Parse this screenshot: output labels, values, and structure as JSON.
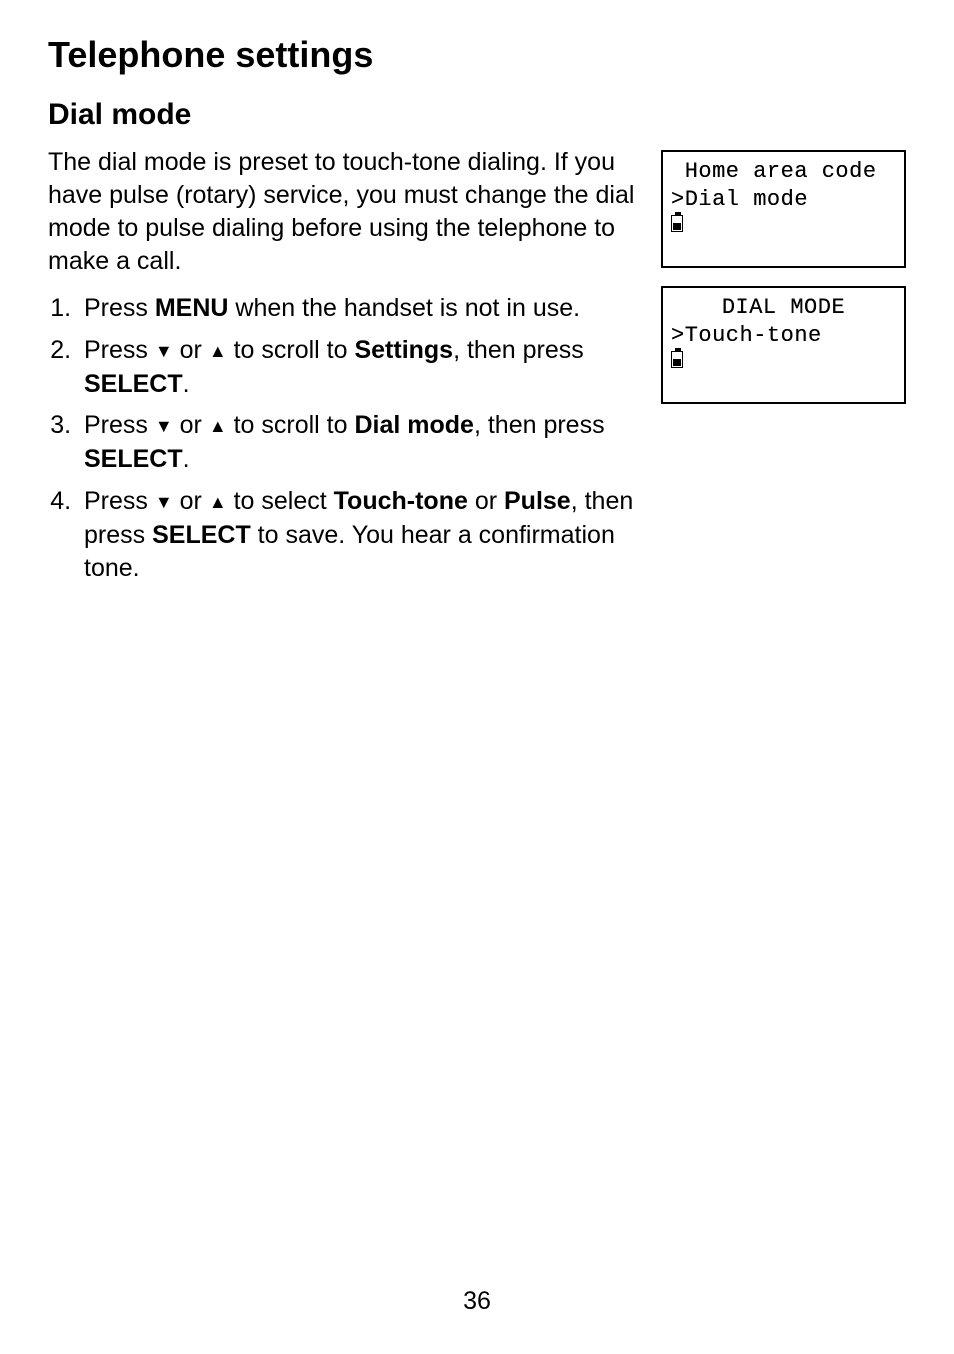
{
  "page": {
    "h1": "Telephone settings",
    "h2": "Dial mode",
    "intro": "The dial mode is preset to touch-tone dialing. If you have pulse (rotary) service, you must change the dial mode to pulse dialing before using the telephone to make a call.",
    "number": "36"
  },
  "steps": {
    "s1_a": "Press ",
    "s1_b": "MENU",
    "s1_c": " when the handset is not in use.",
    "s2_a": "Press ",
    "s2_b": " or ",
    "s2_c": " to scroll to ",
    "s2_d": "Settings",
    "s2_e": ", then press ",
    "s2_f": "SELECT",
    "s2_g": ".",
    "s3_a": "Press ",
    "s3_b": " or ",
    "s3_c": " to scroll to ",
    "s3_d": "Dial mode",
    "s3_e": ", then press ",
    "s3_f": "SELECT",
    "s3_g": ".",
    "s4_a": "Press ",
    "s4_b": " or ",
    "s4_c": " to select ",
    "s4_d": "Touch-tone",
    "s4_e": " or ",
    "s4_f": "Pulse",
    "s4_g": ", then press ",
    "s4_h": "SELECT",
    "s4_i": " to save. You hear a confirmation tone."
  },
  "arrows": {
    "down": "▼",
    "up": "▲"
  },
  "lcd1": {
    "line1": " Home area code",
    "line2": ">Dial mode"
  },
  "lcd2": {
    "line1": "DIAL MODE",
    "line2": ">Touch-tone"
  }
}
